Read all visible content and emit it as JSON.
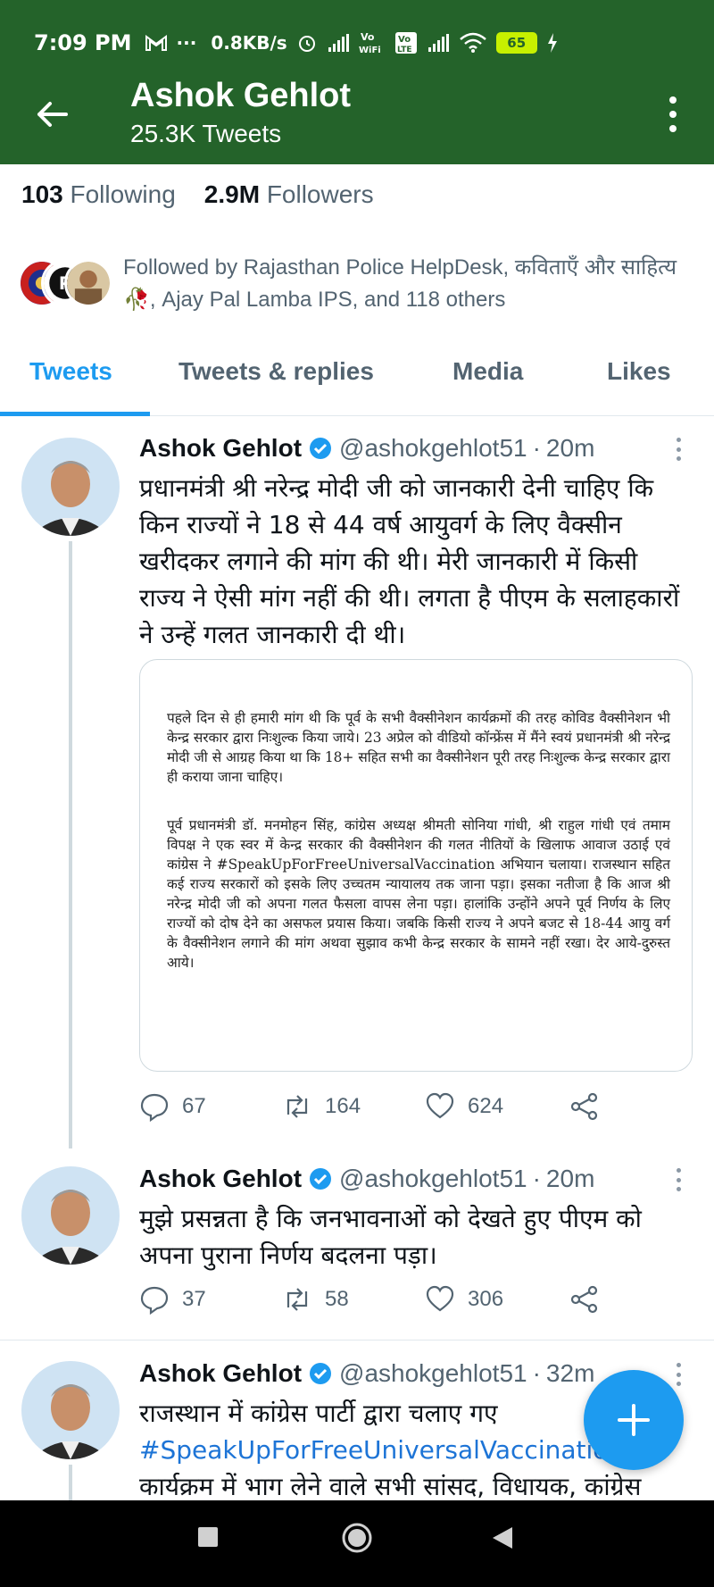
{
  "status_bar": {
    "time": "7:09 PM",
    "icons": [
      "gmail-icon",
      "more-dots",
      "alarm-icon",
      "signal-icon",
      "vowifi-icon",
      "volte-icon",
      "signal-icon",
      "wifi-icon"
    ],
    "speed": "0.8KB/s",
    "vowifi": "Vo\nWiFi",
    "volte": "Vo\nLTE",
    "battery": "65"
  },
  "header": {
    "title": "Ashok Gehlot",
    "subtitle": "25.3K Tweets"
  },
  "profile": {
    "following_count": "103",
    "following_label": "Following",
    "followers_count": "2.9M",
    "followers_label": "Followers",
    "followed_by": "Followed by Rajasthan Police HelpDesk, कविताएँ और साहित्य 🥀, Ajay Pal Lamba IPS, and 118 others"
  },
  "tabs": [
    {
      "label": "Tweets",
      "active": true
    },
    {
      "label": "Tweets & replies",
      "active": false
    },
    {
      "label": "Media",
      "active": false
    },
    {
      "label": "Likes",
      "active": false
    }
  ],
  "tweets": [
    {
      "name": "Ashok Gehlot",
      "handle": "@ashokgehlot51",
      "separator": "·",
      "time": "20m",
      "text": "प्रधानमंत्री श्री नरेन्द्र मोदी जी को जानकारी देनी चाहिए कि किन राज्यों ने 18 से 44 वर्ष आयुवर्ग के लिए वैक्सीन खरीदकर लगाने की मांग की थी। मेरी जानकारी में किसी राज्य ने ऐसी मांग नहीं की थी। लगता है पीएम के सलाहकारों ने उन्हें गलत जानकारी दी थी।",
      "media_paragraphs": [
        "पहले दिन से ही हमारी मांग थी कि पूर्व के सभी वैक्सीनेशन कार्यक्रमों की तरह कोविड वैक्सीनेशन भी केन्द्र सरकार द्वारा निःशुल्क किया जाये। 23 अप्रेल को वीडियो कॉन्फ्रेंस में मैंने स्वयं प्रधानमंत्री श्री नरेन्द्र मोदी जी से आग्रह किया था कि 18+ सहित सभी का वैक्सीनेशन पूरी तरह निःशुल्क केन्द्र सरकार द्वारा ही कराया जाना चाहिए।",
        "पूर्व प्रधानमंत्री डॉ. मनमोहन सिंह, कांग्रेस अध्यक्ष श्रीमती सोनिया गांधी, श्री राहुल गांधी एवं तमाम विपक्ष ने एक स्वर में केन्द्र सरकार की वैक्सीनेशन की गलत नीतियों के खिलाफ आवाज उठाई एवं कांग्रेस ने #SpeakUpForFreeUniversalVaccination अभियान चलाया। राजस्थान सहित कई राज्य सरकारों को इसके लिए उच्चतम न्यायालय तक जाना पड़ा। इसका नतीजा है कि आज श्री नरेन्द्र मोदी जी को अपना गलत फैसला वापस लेना पड़ा। हालांकि उन्होंने अपने पूर्व निर्णय के लिए राज्यों को दोष देने का असफल प्रयास किया। जबकि किसी राज्य ने अपने बजट से 18-44 आयु वर्ग के वैक्सीनेशन लगाने की मांग अथवा सुझाव कभी केन्द्र सरकार के सामने नहीं रखा। देर आये-दुरुस्त आये।"
      ],
      "replies": "67",
      "retweets": "164",
      "likes": "624"
    },
    {
      "name": "Ashok Gehlot",
      "handle": "@ashokgehlot51",
      "separator": "·",
      "time": "20m",
      "text": "मुझे प्रसन्नता है कि जनभावनाओं को देखते हुए पीएम को अपना पुराना निर्णय बदलना पड़ा।",
      "replies": "37",
      "retweets": "58",
      "likes": "306"
    },
    {
      "name": "Ashok Gehlot",
      "handle": "@ashokgehlot51",
      "separator": "·",
      "time": "32m",
      "text_before": "राजस्थान में कांग्रेस पार्टी द्वारा चलाए गए",
      "hashtag": "#SpeakUpForFreeUniversalVaccinatio",
      "text_after": "कार्यक्रम में भाग लेने वाले सभी सांसद, विधायक, कांग्रेस"
    }
  ],
  "colors": {
    "header_bg": "#24632a",
    "accent": "#1d9bf0",
    "muted_text": "#536471"
  }
}
